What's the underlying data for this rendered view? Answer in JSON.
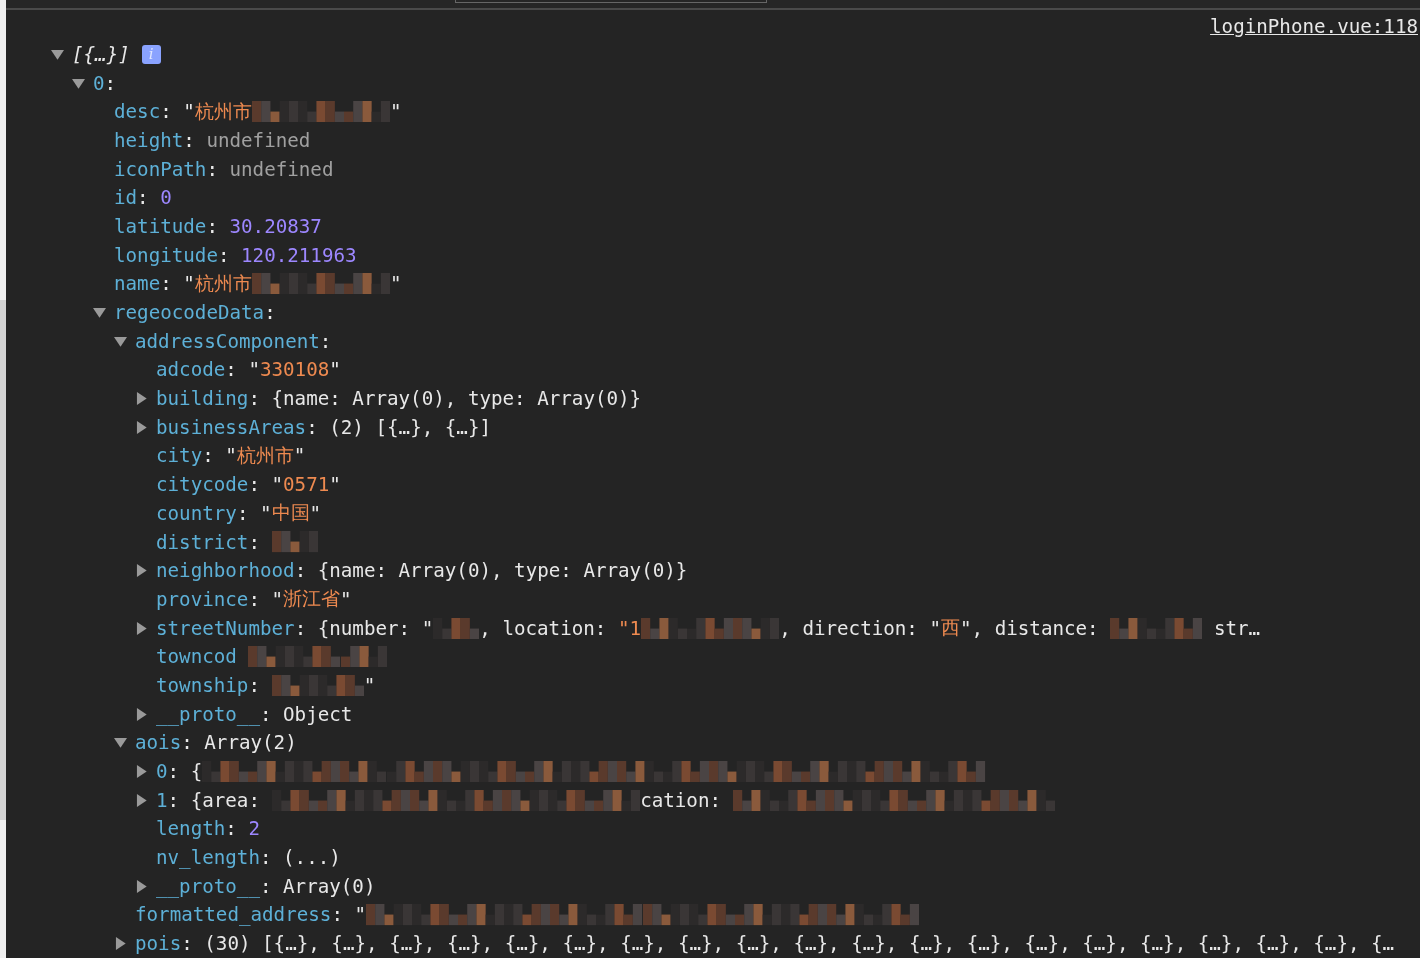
{
  "source_link": "loginPhone.vue:118",
  "tree": {
    "label": "[{…}]",
    "badge": "i",
    "expanded": true,
    "children": [
      {
        "key": "0",
        "separator": ":",
        "expanded": true,
        "children": [
          {
            "key": "desc",
            "separator": ":",
            "value": [
              {
                "kind": "plain",
                "text": "\""
              },
              {
                "kind": "string",
                "text": "杭州市"
              },
              {
                "kind": "redacted"
              },
              {
                "kind": "redacted"
              },
              {
                "kind": "redacted"
              },
              {
                "kind": "plain",
                "text": "\""
              }
            ]
          },
          {
            "key": "height",
            "separator": ":",
            "value": [
              {
                "kind": "undefined",
                "text": "undefined"
              }
            ]
          },
          {
            "key": "iconPath",
            "separator": ":",
            "value": [
              {
                "kind": "undefined",
                "text": "undefined"
              }
            ]
          },
          {
            "key": "id",
            "separator": ":",
            "value": [
              {
                "kind": "number",
                "text": "0"
              }
            ]
          },
          {
            "key": "latitude",
            "separator": ":",
            "value": [
              {
                "kind": "number",
                "text": "30.20837"
              }
            ]
          },
          {
            "key": "longitude",
            "separator": ":",
            "value": [
              {
                "kind": "number",
                "text": "120.211963"
              }
            ]
          },
          {
            "key": "name",
            "separator": ":",
            "value": [
              {
                "kind": "plain",
                "text": "\""
              },
              {
                "kind": "string",
                "text": "杭州市"
              },
              {
                "kind": "redacted"
              },
              {
                "kind": "redacted"
              },
              {
                "kind": "redacted"
              },
              {
                "kind": "plain",
                "text": "\""
              }
            ]
          },
          {
            "key": "regeocodeData",
            "separator": ":",
            "expanded": true,
            "children": [
              {
                "key": "addressComponent",
                "separator": ":",
                "expanded": true,
                "children": [
                  {
                    "key": "adcode",
                    "separator": ":",
                    "value": [
                      {
                        "kind": "plain",
                        "text": "\""
                      },
                      {
                        "kind": "string",
                        "text": "330108"
                      },
                      {
                        "kind": "plain",
                        "text": "\""
                      }
                    ]
                  },
                  {
                    "key": "building",
                    "separator": ":",
                    "expanded": false,
                    "value": [
                      {
                        "kind": "plain",
                        "text": "{name: Array(0), type: Array(0)}"
                      }
                    ]
                  },
                  {
                    "key": "businessAreas",
                    "separator": ":",
                    "expanded": false,
                    "value": [
                      {
                        "kind": "plain",
                        "text": "(2) [{…}, {…}]"
                      }
                    ]
                  },
                  {
                    "key": "city",
                    "separator": ":",
                    "value": [
                      {
                        "kind": "plain",
                        "text": "\""
                      },
                      {
                        "kind": "string",
                        "text": "杭州市"
                      },
                      {
                        "kind": "plain",
                        "text": "\""
                      }
                    ]
                  },
                  {
                    "key": "citycode",
                    "separator": ":",
                    "value": [
                      {
                        "kind": "plain",
                        "text": "\""
                      },
                      {
                        "kind": "string",
                        "text": "0571"
                      },
                      {
                        "kind": "plain",
                        "text": "\""
                      }
                    ]
                  },
                  {
                    "key": "country",
                    "separator": ":",
                    "value": [
                      {
                        "kind": "plain",
                        "text": "\""
                      },
                      {
                        "kind": "string",
                        "text": "中国"
                      },
                      {
                        "kind": "plain",
                        "text": "\""
                      }
                    ]
                  },
                  {
                    "key": "district",
                    "separator": ":",
                    "value": [
                      {
                        "kind": "redacted"
                      }
                    ]
                  },
                  {
                    "key": "neighborhood",
                    "separator": ":",
                    "expanded": false,
                    "value": [
                      {
                        "kind": "plain",
                        "text": "{name: Array(0), type: Array(0)}"
                      }
                    ]
                  },
                  {
                    "key": "province",
                    "separator": ":",
                    "value": [
                      {
                        "kind": "plain",
                        "text": "\""
                      },
                      {
                        "kind": "string",
                        "text": "浙江省"
                      },
                      {
                        "kind": "plain",
                        "text": "\""
                      }
                    ]
                  },
                  {
                    "key": "streetNumber",
                    "separator": ":",
                    "expanded": false,
                    "value": [
                      {
                        "kind": "plain",
                        "text": "{number: \""
                      },
                      {
                        "kind": "redacted"
                      },
                      {
                        "kind": "plain",
                        "text": ", location: "
                      },
                      {
                        "kind": "string",
                        "text": "\"1"
                      },
                      {
                        "kind": "redacted"
                      },
                      {
                        "kind": "redacted"
                      },
                      {
                        "kind": "redacted"
                      },
                      {
                        "kind": "plain",
                        "text": ", direction: \""
                      },
                      {
                        "kind": "string",
                        "text": "西"
                      },
                      {
                        "kind": "plain",
                        "text": "\", distance: "
                      },
                      {
                        "kind": "redacted"
                      },
                      {
                        "kind": "redacted"
                      },
                      {
                        "kind": "plain",
                        "text": " str…"
                      }
                    ]
                  },
                  {
                    "key": "towncod",
                    "value": [
                      {
                        "kind": "redacted"
                      },
                      {
                        "kind": "redacted"
                      },
                      {
                        "kind": "redacted"
                      }
                    ]
                  },
                  {
                    "key": "township",
                    "separator": ":",
                    "value": [
                      {
                        "kind": "redacted"
                      },
                      {
                        "kind": "redacted"
                      },
                      {
                        "kind": "plain",
                        "text": "\""
                      }
                    ]
                  },
                  {
                    "key": "__proto__",
                    "separator": ":",
                    "expanded": false,
                    "value": [
                      {
                        "kind": "plain",
                        "text": "Object"
                      }
                    ]
                  }
                ]
              },
              {
                "key": "aois",
                "separator": ":",
                "expanded": true,
                "value": [
                  {
                    "kind": "plain",
                    "text": "Array(2)"
                  }
                ],
                "children": [
                  {
                    "key": "0",
                    "separator": ":",
                    "expanded": false,
                    "value": [
                      {
                        "kind": "plain",
                        "text": "{"
                      },
                      {
                        "kind": "redacted"
                      },
                      {
                        "kind": "redacted"
                      },
                      {
                        "kind": "redacted"
                      },
                      {
                        "kind": "redacted"
                      },
                      {
                        "kind": "redacted"
                      },
                      {
                        "kind": "redacted"
                      },
                      {
                        "kind": "redacted"
                      },
                      {
                        "kind": "redacted"
                      },
                      {
                        "kind": "redacted"
                      },
                      {
                        "kind": "redacted"
                      },
                      {
                        "kind": "redacted"
                      },
                      {
                        "kind": "redacted"
                      },
                      {
                        "kind": "redacted"
                      },
                      {
                        "kind": "redacted"
                      },
                      {
                        "kind": "redacted"
                      },
                      {
                        "kind": "redacted"
                      },
                      {
                        "kind": "redacted"
                      }
                    ]
                  },
                  {
                    "key": "1",
                    "separator": ":",
                    "expanded": false,
                    "value": [
                      {
                        "kind": "plain",
                        "text": "{area: "
                      },
                      {
                        "kind": "redacted"
                      },
                      {
                        "kind": "redacted"
                      },
                      {
                        "kind": "redacted"
                      },
                      {
                        "kind": "redacted"
                      },
                      {
                        "kind": "redacted"
                      },
                      {
                        "kind": "redacted"
                      },
                      {
                        "kind": "redacted"
                      },
                      {
                        "kind": "redacted"
                      },
                      {
                        "kind": "plain",
                        "text": "cation: "
                      },
                      {
                        "kind": "redacted"
                      },
                      {
                        "kind": "redacted"
                      },
                      {
                        "kind": "redacted"
                      },
                      {
                        "kind": "redacted"
                      },
                      {
                        "kind": "redacted"
                      },
                      {
                        "kind": "redacted"
                      },
                      {
                        "kind": "redacted"
                      }
                    ]
                  },
                  {
                    "key": "length",
                    "separator": ":",
                    "value": [
                      {
                        "kind": "number",
                        "text": "2"
                      }
                    ]
                  },
                  {
                    "key": "nv_length",
                    "separator": ":",
                    "value": [
                      {
                        "kind": "plain",
                        "text": "(...)"
                      }
                    ]
                  },
                  {
                    "key": "__proto__",
                    "separator": ":",
                    "expanded": false,
                    "value": [
                      {
                        "kind": "plain",
                        "text": "Array(0)"
                      }
                    ]
                  }
                ]
              },
              {
                "key": "formatted_address",
                "separator": ":",
                "value": [
                  {
                    "kind": "plain",
                    "text": "\""
                  },
                  {
                    "kind": "redacted"
                  },
                  {
                    "kind": "redacted"
                  },
                  {
                    "kind": "redacted"
                  },
                  {
                    "kind": "redacted"
                  },
                  {
                    "kind": "redacted"
                  },
                  {
                    "kind": "redacted"
                  },
                  {
                    "kind": "redacted"
                  },
                  {
                    "kind": "redacted"
                  },
                  {
                    "kind": "redacted"
                  },
                  {
                    "kind": "redacted"
                  },
                  {
                    "kind": "redacted"
                  },
                  {
                    "kind": "redacted"
                  }
                ]
              },
              {
                "key": "pois",
                "separator": ":",
                "expanded": false,
                "value": [
                  {
                    "kind": "plain",
                    "text": "(30) [{…}, {…}, {…}, {…}, {…}, {…}, {…}, {…}, {…}, {…}, {…}, {…}, {…}, {…}, {…}, {…}, {…}, {…}, {…}, {…"
                  }
                ]
              }
            ]
          }
        ]
      }
    ]
  }
}
